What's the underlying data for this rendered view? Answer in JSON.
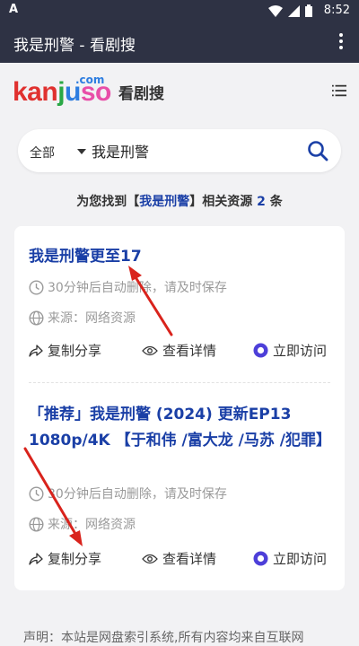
{
  "status_bar": {
    "time": "8:52",
    "notification_glyph": "A"
  },
  "app_bar": {
    "title": "我是刑警 - 看剧搜"
  },
  "site": {
    "logo_text": "kanjuso",
    "logo_suffix": ".com",
    "name": "看剧搜"
  },
  "search": {
    "category": "全部",
    "query": "我是刑警"
  },
  "results_summary": {
    "prefix": "为您找到【",
    "keyword": "我是刑警",
    "middle": "】相关资源",
    "count": "2",
    "suffix": "条"
  },
  "results": [
    {
      "title": "我是刑警更至17",
      "expiry": "30分钟后自动删除，请及时保存",
      "source": "来源：网络资源",
      "share": "复制分享",
      "details": "查看详情",
      "visit": "立即访问"
    },
    {
      "title": "「推荐」我是刑警 (2024) 更新EP13 1080p/4K 【于和伟 /富大龙 /马苏 /犯罪】",
      "expiry": "30分钟后自动删除，请及时保存",
      "source": "来源：网络资源",
      "share": "复制分享",
      "details": "查看详情",
      "visit": "立即访问"
    }
  ],
  "footer": {
    "disclaimer": "声明：本站是网盘索引系统,所有内容均来自互联网"
  },
  "colors": {
    "app_bar": "#2e3244",
    "link": "#1a3fa6",
    "visit_icon": "#4d3fd9",
    "annotation_arrow": "#d9231c"
  }
}
